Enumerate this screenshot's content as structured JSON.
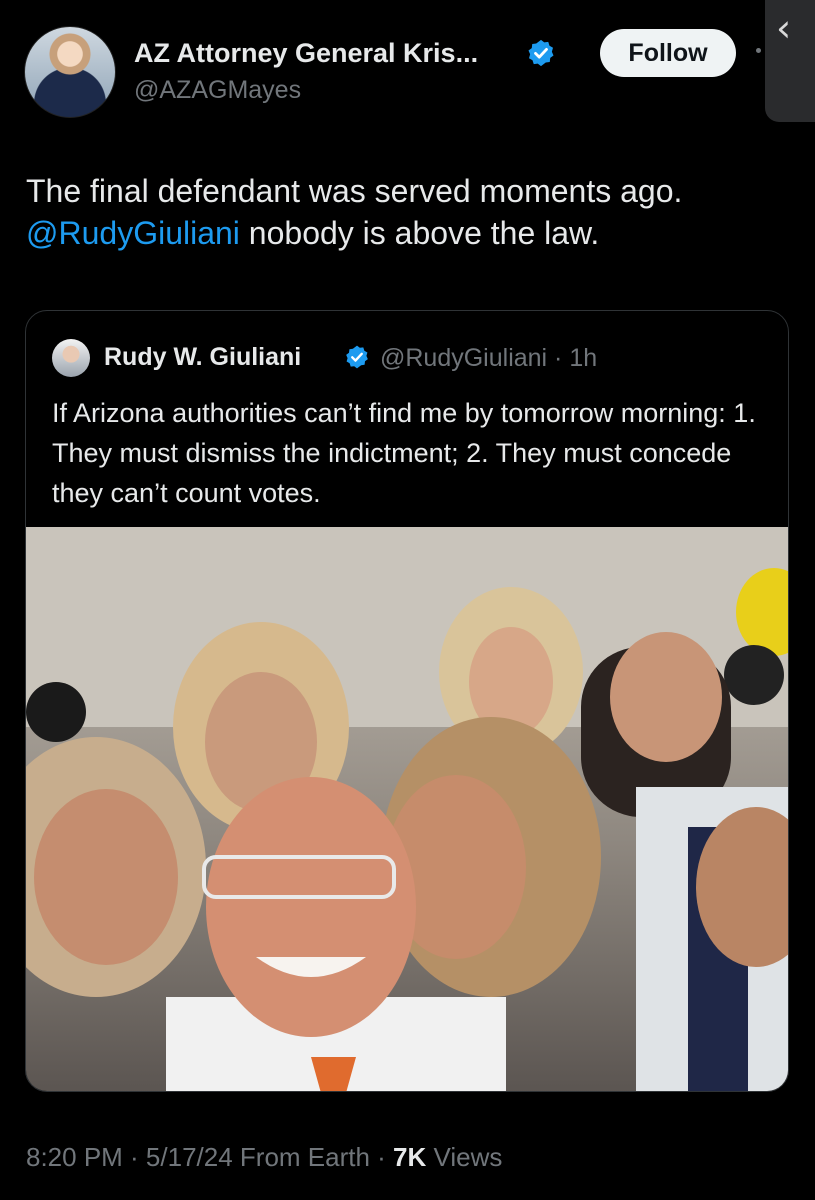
{
  "header": {
    "display_name": "AZ Attorney General Kris...",
    "handle": "@AZAGMayes",
    "follow_label": "Follow"
  },
  "tweet": {
    "line1": "The final defendant was served moments ago.",
    "mention": "@RudyGiuliani",
    "line2_rest": " nobody is above the law."
  },
  "quote": {
    "name": "Rudy W. Giuliani",
    "handle_time": "@RudyGiuliani · 1h",
    "text": "If Arizona authorities can’t find me by tomorrow morning: 1. They must dismiss the indictment; 2. They must concede they can’t count votes."
  },
  "footer": {
    "time_date": "8:20 PM · 5/17/24 From Earth · ",
    "views_count": "7K",
    "views_label": " Views"
  },
  "colors": {
    "background": "#000000",
    "text": "#e7e9ea",
    "muted": "#71767b",
    "link": "#1d9bf0",
    "verified": "#1d9bf0"
  },
  "icons": {
    "verified": "verified-badge-icon",
    "back": "chevron-left-icon"
  }
}
